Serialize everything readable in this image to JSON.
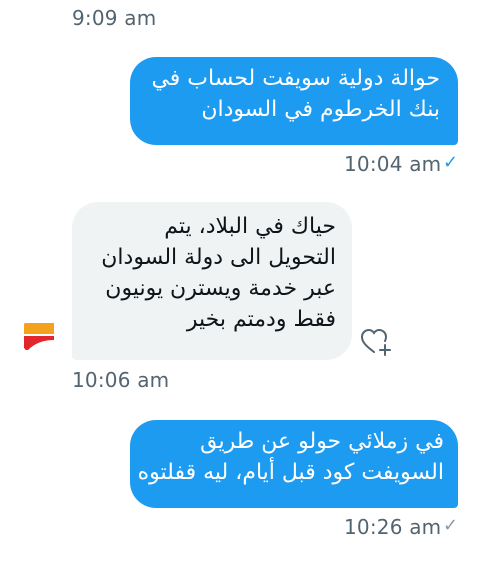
{
  "messages": [
    {
      "kind": "timestamp",
      "time": "9:09 am"
    },
    {
      "kind": "sent",
      "lines": [
        "حوالة دولية سويفت لحساب في",
        "بنك الخرطوم في السودان"
      ],
      "time": "10:04 am",
      "status": "✓"
    },
    {
      "kind": "received",
      "lines": [
        "حياك في البلاد، يتم",
        "التحويل الى دولة السودان",
        "عبر خدمة ويسترن يونيون",
        "فقط ودمتم بخير"
      ],
      "time": "10:06 am"
    },
    {
      "kind": "sent",
      "lines": [
        "في زملائي حولو عن طريق",
        "السويفت كود قبل أيام، ليه قفلتوه"
      ],
      "time": "10:26 am",
      "status": "✓"
    }
  ],
  "colors": {
    "sent_bubble": "#1d9bf0",
    "received_bubble": "#eff3f4",
    "timestamp_text": "#536471",
    "read_check": "#1d9bf0",
    "sent_check": "#8b98a5"
  },
  "icons": {
    "avatar": "bank-logo-icon",
    "reaction": "add-reaction-heart-icon"
  }
}
